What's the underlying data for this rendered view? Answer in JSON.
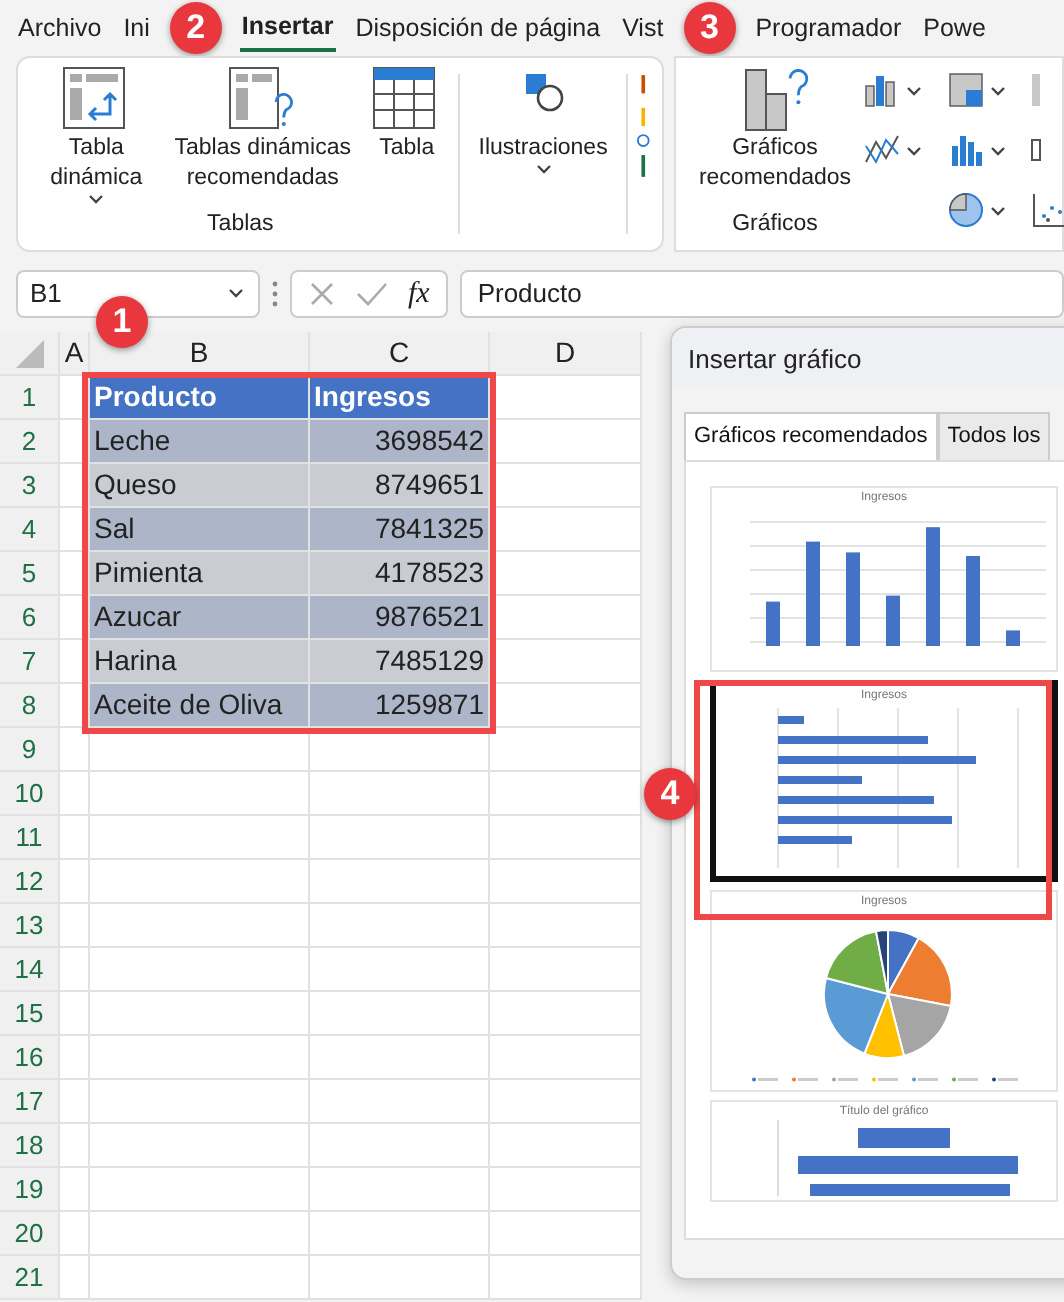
{
  "ribbon_tabs": [
    {
      "label": "Archivo",
      "selected": false
    },
    {
      "label": "Ini",
      "selected": false
    },
    {
      "label": "Insertar",
      "selected": true
    },
    {
      "label": "Disposición de página",
      "selected": false
    },
    {
      "label": "Vist",
      "selected": false
    },
    {
      "label": "Programador",
      "selected": false
    },
    {
      "label": "Powe",
      "selected": false
    }
  ],
  "ribbon_groups": [
    {
      "label": "Tablas",
      "buttons": [
        {
          "kind": "pivot",
          "label": "Tabla dinámica",
          "dropdown": true
        },
        {
          "kind": "recommended_pivot",
          "label": "Tablas dinámicas recomendadas",
          "dropdown": false
        },
        {
          "kind": "table",
          "label": "Tabla",
          "dropdown": false
        }
      ]
    },
    {
      "buttons": [
        {
          "kind": "illustrations",
          "label": "Ilustraciones",
          "dropdown": true
        }
      ]
    },
    {
      "label": "Gráficos",
      "buttons": [
        {
          "kind": "recommended_charts",
          "label": "Gráficos recomendados",
          "dropdown": false
        }
      ]
    }
  ],
  "formula_bar": {
    "name_box": "B1",
    "function_label": "fx",
    "formula": "Producto"
  },
  "sheet": {
    "columns": [
      "A",
      "B",
      "C",
      "D"
    ],
    "row_numbers": [
      "1",
      "2",
      "3",
      "4",
      "5",
      "6",
      "7",
      "8",
      "9",
      "10",
      "11",
      "12",
      "13",
      "14",
      "15",
      "16",
      "17",
      "18",
      "19",
      "20",
      "21"
    ]
  },
  "table": {
    "header": [
      "Producto",
      "Ingresos"
    ],
    "rows": [
      [
        "Leche",
        "3698542"
      ],
      [
        "Queso",
        "8749651"
      ],
      [
        "Sal",
        "7841325"
      ],
      [
        "Pimienta",
        "4178523"
      ],
      [
        "Azucar",
        "9876521"
      ],
      [
        "Harina",
        "7485129"
      ],
      [
        "Aceite de Oliva",
        "1259871"
      ]
    ]
  },
  "dialog": {
    "title": "Insertar gráfico",
    "tabs": [
      {
        "label": "Gráficos recomendados",
        "selected": true
      },
      {
        "label": "Todos los",
        "selected": false
      }
    ],
    "thumbnails": [
      {
        "kind": "column",
        "title": "Ingresos",
        "selected": false
      },
      {
        "kind": "bar",
        "title": "Ingresos",
        "selected": true
      },
      {
        "kind": "pie",
        "title": "Ingresos",
        "selected": false
      },
      {
        "kind": "bar_labeled",
        "title": "Título del gráfico",
        "selected": false
      }
    ]
  },
  "annotations": [
    "1",
    "2",
    "3",
    "4"
  ]
}
